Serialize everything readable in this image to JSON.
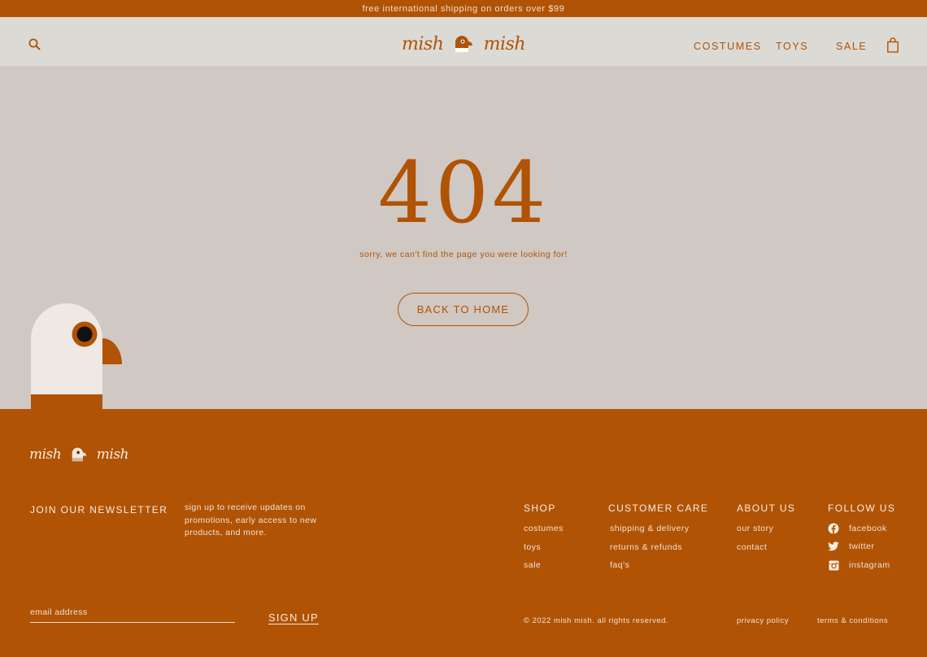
{
  "announcement": "free international shipping on orders over $99",
  "header": {
    "logo_left": "mish",
    "logo_right": "mish",
    "nav": [
      "COSTUMES",
      "TOYS",
      "SALE"
    ],
    "icons": {
      "search": "search-icon",
      "cart": "shopping-bag-icon"
    }
  },
  "main": {
    "error_code": "404",
    "message": "sorry, we can't find the page you were looking for!",
    "back_button": "BACK TO HOME"
  },
  "footer": {
    "logo_left": "mish",
    "logo_right": "mish",
    "newsletter": {
      "title": "JOIN OUR NEWSLETTER",
      "description": "sign up to receive updates on promotions, early access to new products, and more.",
      "email_placeholder": "email address",
      "signup": "SIGN UP"
    },
    "shop": {
      "title": "SHOP",
      "links": [
        "costumes",
        "toys",
        "sale"
      ]
    },
    "care": {
      "title": "CUSTOMER CARE",
      "links": [
        "shipping & delivery",
        "returns & refunds",
        "faq's"
      ]
    },
    "about": {
      "title": "ABOUT US",
      "links": [
        "our story",
        "contact"
      ]
    },
    "follow": {
      "title": "FOLLOW US",
      "links": [
        {
          "label": "facebook",
          "icon": "facebook-icon"
        },
        {
          "label": "twitter",
          "icon": "twitter-icon"
        },
        {
          "label": "instagram",
          "icon": "instagram-icon"
        }
      ]
    },
    "copyright": "© 2022 mish mish. all rights reserved.",
    "privacy": "privacy policy",
    "terms": "terms & conditions"
  },
  "colors": {
    "brand_orange": "#b05304",
    "header_bg": "#dcdad5",
    "page_bg": "#d0c8c2",
    "cream": "#efe9e3"
  }
}
